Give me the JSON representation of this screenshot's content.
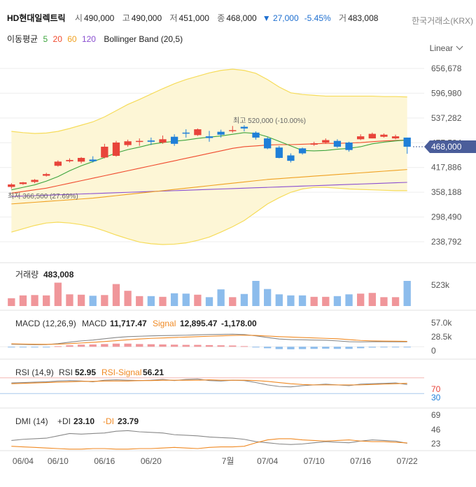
{
  "header": {
    "name": "HD현대일렉트릭",
    "open_label": "시",
    "open": "490,000",
    "high_label": "고",
    "high": "490,000",
    "low_label": "저",
    "low": "451,000",
    "close_label": "종",
    "close": "468,000",
    "change_arrow": "▼",
    "change": "27,000",
    "change_pct": "-5.45%",
    "volume_label": "거",
    "volume": "483,008",
    "exchange": "한국거래소(KRX)",
    "scale": "Linear"
  },
  "indicators": {
    "ma_label": "이동평균",
    "ma_periods": [
      "5",
      "20",
      "60",
      "120"
    ],
    "ma_colors": [
      "#3ca43c",
      "#f04a2e",
      "#f0a020",
      "#8a4fd0"
    ],
    "bb_label": "Bollinger Band (20,5)"
  },
  "colors": {
    "up": "#e8443a",
    "down": "#1f7fd8",
    "bb_line": "#f6dc5a",
    "bb_fill": "#fdf6d6",
    "price_tag": "#4a5d9a"
  },
  "chart_data": [
    {
      "type": "candlestick",
      "x": [
        "06/03",
        "06/04",
        "06/05",
        "06/07",
        "06/10",
        "06/11",
        "06/12",
        "06/13",
        "06/14",
        "06/17",
        "06/18",
        "06/19",
        "06/20",
        "06/21",
        "06/24",
        "06/25",
        "06/26",
        "06/27",
        "06/28",
        "07/01",
        "07/02",
        "07/03",
        "07/04",
        "07/05",
        "07/08",
        "07/09",
        "07/10",
        "07/11",
        "07/12",
        "07/15",
        "07/16",
        "07/17",
        "07/18",
        "07/19",
        "07/22"
      ],
      "xticks": [
        "06/04",
        "06/10",
        "06/16",
        "06/20",
        "7월",
        "07/04",
        "07/10",
        "07/16",
        "07/22"
      ],
      "open": [
        371000,
        378000,
        383000,
        398000,
        422000,
        433000,
        432000,
        437000,
        442000,
        446000,
        472000,
        480000,
        483000,
        478000,
        492000,
        502000,
        496000,
        493000,
        504000,
        507000,
        516000,
        502000,
        488000,
        466000,
        447000,
        464000,
        473000,
        478000,
        482000,
        478000,
        486000,
        488000,
        492000,
        488000,
        490000
      ],
      "close": [
        377000,
        382000,
        388000,
        402000,
        432000,
        436000,
        441000,
        433000,
        468000,
        478000,
        481000,
        482000,
        480000,
        486000,
        475000,
        500000,
        510000,
        489000,
        497000,
        508000,
        512000,
        490000,
        464000,
        441000,
        434000,
        452000,
        476000,
        484000,
        468000,
        460000,
        493000,
        499000,
        497000,
        493000,
        468000
      ],
      "high": [
        380000,
        383000,
        390000,
        405000,
        435000,
        440000,
        443000,
        445000,
        475000,
        482000,
        485000,
        488000,
        490000,
        495000,
        498000,
        510000,
        512000,
        506000,
        509000,
        518000,
        520000,
        505000,
        492000,
        470000,
        452000,
        466000,
        480000,
        488000,
        486000,
        480000,
        498000,
        502000,
        500000,
        497000,
        490000
      ],
      "low": [
        366500,
        376000,
        380000,
        396000,
        420000,
        430000,
        428000,
        430000,
        440000,
        444000,
        468000,
        470000,
        472000,
        475000,
        470000,
        490000,
        494000,
        480000,
        490000,
        502000,
        505000,
        485000,
        462000,
        440000,
        430000,
        449000,
        470000,
        475000,
        465000,
        456000,
        484000,
        488000,
        490000,
        486000,
        451000
      ],
      "ma5": [
        364000,
        370000,
        376000,
        385000,
        396000,
        410000,
        422000,
        432000,
        442000,
        453000,
        461000,
        467000,
        474000,
        478000,
        481000,
        484000,
        488000,
        491000,
        494000,
        498000,
        502000,
        500000,
        492000,
        481000,
        470000,
        459000,
        458000,
        459000,
        462000,
        464000,
        468000,
        475000,
        479000,
        482000,
        484000
      ],
      "ma20": [
        356000,
        360000,
        364000,
        368000,
        374000,
        380000,
        386000,
        392000,
        398000,
        404000,
        410000,
        416000,
        422000,
        428000,
        434000,
        440000,
        446000,
        452000,
        458000,
        464000,
        468000,
        470000,
        472000,
        473000,
        473000,
        474000,
        475000,
        476000,
        476000,
        477000,
        478000,
        480000,
        482000,
        483000,
        484000
      ],
      "ma60": [
        330000,
        332000,
        334000,
        336000,
        338000,
        340000,
        342000,
        344000,
        347000,
        350000,
        353000,
        356000,
        359000,
        362000,
        365000,
        368000,
        371000,
        374000,
        377000,
        380000,
        383000,
        386000,
        389000,
        391000,
        393000,
        395000,
        397000,
        399000,
        401000,
        403000,
        405000,
        407000,
        409000,
        411000,
        413000
      ],
      "ma120": [
        348000,
        349000,
        350000,
        351000,
        352000,
        353000,
        354000,
        355000,
        356000,
        357000,
        358000,
        359000,
        360000,
        361000,
        362000,
        363000,
        364000,
        365000,
        366000,
        367000,
        368000,
        369000,
        370000,
        371000,
        372000,
        373000,
        374000,
        375000,
        376000,
        377000,
        378000,
        379000,
        380000,
        381000,
        382000
      ],
      "bb_upper": [
        505000,
        502000,
        500000,
        501000,
        505000,
        512000,
        520000,
        528000,
        540000,
        555000,
        570000,
        582000,
        595000,
        608000,
        620000,
        630000,
        638000,
        646000,
        652000,
        655000,
        652000,
        645000,
        630000,
        612000,
        598000,
        594000,
        592000,
        590000,
        590000,
        590000,
        590000,
        590000,
        589000,
        589000,
        588000
      ],
      "bb_lower": [
        262000,
        270000,
        278000,
        284000,
        286000,
        284000,
        280000,
        274000,
        265000,
        255000,
        246000,
        238000,
        234000,
        232000,
        233000,
        236000,
        242000,
        250000,
        262000,
        275000,
        290000,
        310000,
        330000,
        345000,
        358000,
        366000,
        370000,
        370000,
        368000,
        366000,
        365000,
        364000,
        363000,
        362000,
        362000
      ],
      "yticks": [
        "656,678",
        "596,980",
        "537,282",
        "477,584",
        "417,886",
        "358,188",
        "298,490",
        "238,792"
      ],
      "ylim": [
        238792,
        656678
      ],
      "max_label": "최고 520,000 (-10.00%)",
      "min_label": "최저 366,500 (27.69%)",
      "last_price": "468,000"
    },
    {
      "type": "bar",
      "title": "거래량",
      "value_label": "483,008",
      "values": [
        110,
        150,
        155,
        150,
        330,
        165,
        160,
        145,
        155,
        310,
        215,
        140,
        140,
        130,
        180,
        175,
        160,
        125,
        235,
        125,
        170,
        355,
        240,
        165,
        150,
        150,
        130,
        130,
        140,
        165,
        175,
        185,
        125,
        125,
        355
      ],
      "yticks": [
        "523k"
      ]
    },
    {
      "type": "line",
      "title": "MACD (12,26,9)",
      "macd_label": "MACD",
      "macd_value": "11,717.47",
      "signal_label": "Signal",
      "signal_value": "12,895.47",
      "osc_value": "-1,178.00",
      "yticks": [
        "57.0k",
        "28.5k",
        "0"
      ],
      "macd": [
        6000,
        5500,
        5000,
        5200,
        7500,
        11000,
        14000,
        16000,
        19000,
        22000,
        24000,
        25000,
        26000,
        26500,
        27000,
        27500,
        28500,
        29000,
        29500,
        30000,
        29000,
        26000,
        22000,
        18500,
        17000,
        16500,
        16000,
        15500,
        14000,
        12000,
        11500,
        12000,
        12000,
        11800,
        11717
      ],
      "signal": [
        7000,
        6500,
        6000,
        5800,
        6200,
        7500,
        9000,
        10500,
        12500,
        14500,
        16500,
        18500,
        20000,
        21000,
        22000,
        23000,
        24000,
        25000,
        26000,
        27000,
        27500,
        27000,
        25500,
        24000,
        23000,
        22000,
        21000,
        20000,
        19000,
        17000,
        15000,
        14000,
        13500,
        13200,
        12895
      ],
      "osc": [
        -1000,
        -1000,
        -1000,
        -600,
        1300,
        3500,
        5000,
        5500,
        6500,
        7500,
        7500,
        6500,
        6000,
        5500,
        5000,
        4500,
        4500,
        4000,
        3500,
        3000,
        1500,
        -1000,
        -3500,
        -5500,
        -6000,
        -5500,
        -5000,
        -4500,
        -5000,
        -5000,
        -3500,
        -2000,
        -1500,
        -1400,
        -1178
      ]
    },
    {
      "type": "line",
      "title": "RSI (14,9)",
      "rsi_label": "RSI",
      "rsi_value": "52.95",
      "signal_label": "RSI-Signal",
      "signal_value": "56.21",
      "yticks": [
        "70",
        "30"
      ],
      "rsi": [
        57,
        58,
        59,
        60,
        62,
        63,
        62,
        60,
        64,
        65,
        64,
        63,
        64,
        66,
        63,
        66,
        67,
        63,
        62,
        64,
        63,
        58,
        52,
        48,
        47,
        50,
        52,
        54,
        52,
        50,
        54,
        55,
        56,
        57,
        52.95
      ],
      "signal": [
        55,
        56,
        57,
        58,
        59,
        60,
        61,
        61,
        62,
        62,
        62,
        63,
        63,
        64,
        64,
        64,
        64,
        65,
        64,
        64,
        64,
        63,
        61,
        58,
        55,
        53,
        52,
        52,
        52,
        52,
        52,
        53,
        54,
        55,
        56.21
      ]
    },
    {
      "type": "line",
      "title": "DMI (14)",
      "pdi_label": "+DI",
      "pdi_value": "23.10",
      "mdi_label": "-DI",
      "mdi_value": "23.79",
      "yticks": [
        "69",
        "46",
        "23"
      ],
      "pdi": [
        28,
        30,
        31,
        32,
        36,
        40,
        39,
        40,
        41,
        44,
        45,
        43,
        42,
        41,
        38,
        37,
        36,
        34,
        33,
        32,
        30,
        26,
        24,
        22,
        21,
        22,
        24,
        26,
        25,
        24,
        27,
        29,
        28,
        27,
        23.1
      ],
      "mdi": [
        18,
        17,
        16,
        15,
        14,
        13,
        13,
        14,
        14,
        13,
        13,
        14,
        14,
        15,
        16,
        15,
        14,
        16,
        17,
        17,
        18,
        24,
        29,
        31,
        31,
        29,
        28,
        27,
        28,
        29,
        27,
        26,
        26,
        25,
        23.79
      ]
    }
  ]
}
